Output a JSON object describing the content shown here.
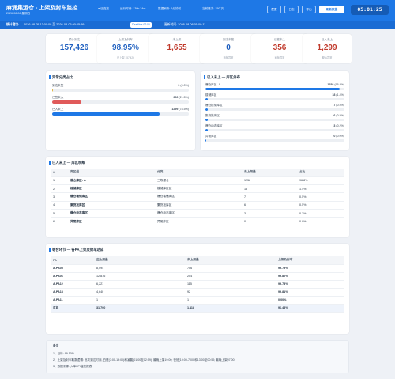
{
  "header": {
    "title": "麻涌集运仓 - 上架及封车监控",
    "subtitle": "2026-08-06 星期四",
    "status": "● 已连接",
    "runtime": "运行时间: 130h 34m",
    "refresh": "数据刷新: 1分钟前",
    "shift": "当前班次: 150 次",
    "buttons": [
      "配置",
      "日志",
      "导出",
      "刷新数据"
    ],
    "clock": "05:01:25"
  },
  "subbar": {
    "window_label": "统计窗口:",
    "window_value": "2026-08-05 13:00:00 至 2026-08-06 00:05:59",
    "deadline": "Deadline 07:00",
    "updated": "更新时间: 2026-08-06 05:00:11"
  },
  "kpis": [
    {
      "label": "预计到达",
      "value": "157,426",
      "sub": "",
      "color": "#1e5fbf"
    },
    {
      "label": "上架及封车",
      "value": "98.95%",
      "sub": "已上架 157,426",
      "color": "#1e5fbf"
    },
    {
      "label": "未上架",
      "value": "1,655",
      "sub": "",
      "color": "#c0392b"
    },
    {
      "label": "到达未签",
      "value": "0",
      "sub": "面板异常",
      "color": "#1e5fbf"
    },
    {
      "label": "已签未入",
      "value": "356",
      "sub": "面板异常",
      "color": "#c0392b"
    },
    {
      "label": "已入未上",
      "value": "1,299",
      "sub": "疑似异常",
      "color": "#c0392b"
    }
  ],
  "exceptions": {
    "title": "异常分类占比",
    "items": [
      {
        "label": "到达未签",
        "value": "0",
        "pct": "(0.0%)",
        "ratio": 0.0,
        "color": "#e0b43a"
      },
      {
        "label": "已签未入",
        "value": "356",
        "pct": "(21.5%)",
        "ratio": 0.215,
        "color": "#e05a5a"
      },
      {
        "label": "已入未上",
        "value": "1299",
        "pct": "(78.5%)",
        "ratio": 0.785,
        "color": "#1e78e6"
      }
    ]
  },
  "zones": {
    "title": "已入未上 — 库区分布",
    "items": [
      {
        "label": "爆仓库区- A",
        "value": "1258",
        "pct": "(96.8%)",
        "ratio": 0.968
      },
      {
        "label": "楼储库区",
        "value": "18",
        "pct": "(1.4%)",
        "ratio": 0.014
      },
      {
        "label": "爆仓楼储库区",
        "value": "7",
        "pct": "(0.5%)",
        "ratio": 0.005
      },
      {
        "label": "集货批库区",
        "value": "6",
        "pct": "(0.5%)",
        "ratio": 0.005
      },
      {
        "label": "爆仓动态库区",
        "value": "3",
        "pct": "(0.2%)",
        "ratio": 0.002
      },
      {
        "label": "异常库区",
        "value": "0",
        "pct": "(0.0%)",
        "ratio": 0.0
      }
    ]
  },
  "detail": {
    "title": "已入未上 — 库区明细",
    "headers": [
      "#",
      "库区组",
      "分类",
      "未上架量",
      "占比"
    ],
    "rows": [
      [
        "1",
        "爆仓库区- A",
        "三等爆仓",
        "1258",
        "96.8%"
      ],
      [
        "2",
        "楼储库区",
        "楼储库区区",
        "18",
        "1.4%"
      ],
      [
        "3",
        "爆仓楼储库区",
        "爆仓楼储库区",
        "7",
        "0.5%"
      ],
      [
        "4",
        "集货批库区",
        "集货批库区",
        "6",
        "0.5%"
      ],
      [
        "5",
        "爆仓动态库区",
        "爆仓动态库区",
        "3",
        "0.2%"
      ],
      [
        "6",
        "异常库区",
        "异常库区",
        "0",
        "0.0%"
      ]
    ]
  },
  "pa": {
    "title": "等合环节 — 各PA上架及封车达成",
    "headers": [
      "PA",
      "应上架量",
      "未上架量",
      "上架及封车"
    ],
    "rows": [
      [
        "A-PA05",
        "8,094",
        "706",
        "99.75%"
      ],
      [
        "A-PA06",
        "12,816",
        "204",
        "99.80%"
      ],
      [
        "A-PA12",
        "6,221",
        "115",
        "99.73%"
      ],
      [
        "A-PA13",
        "4,640",
        "92",
        "99.81%"
      ],
      [
        "A-PA11",
        "1",
        "1",
        "0.00%"
      ]
    ],
    "total": [
      "汇总",
      "31,790",
      "1,118",
      "96.48%"
    ]
  },
  "notes": {
    "title": "备注",
    "lines": [
      "1、目标: 99.50%",
      "2、上架及封车取数逻辑: 批次到达时间, 白班(7:00-19:00)和凌晨(01:00至12:59), 最晚上架19:00; 夜班(19:00-7:00)和13:00至00:59, 最晚上架07:00",
      "3、数据来源: 入库KPI监控报表"
    ]
  },
  "colors": {
    "accent": "#1e78e6",
    "danger": "#c0392b",
    "warn": "#e0b43a"
  }
}
